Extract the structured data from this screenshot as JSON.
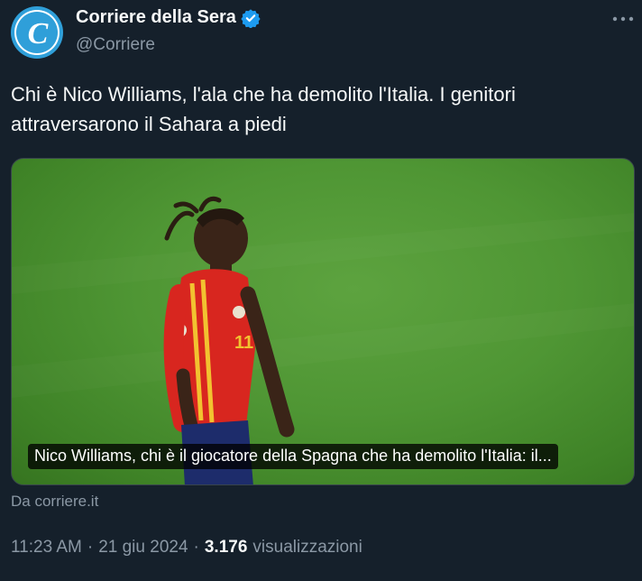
{
  "author": {
    "display_name": "Corriere della Sera",
    "handle": "@Corriere",
    "avatar_letter": "C",
    "verified": true
  },
  "menu": {
    "icon": "more-horizontal-icon"
  },
  "tweet": {
    "text": "Chi è Nico Williams, l'ala che ha demolito l'Italia. I genitori attraversarono il Sahara a piedi"
  },
  "card": {
    "caption": "Nico Williams, chi è il giocatore della Spagna che ha demolito l'Italia: il...",
    "jersey_number": "11",
    "source": "Da corriere.it"
  },
  "meta": {
    "time": "11:23 AM",
    "separator": "·",
    "date": "21 giu 2024",
    "views_count": "3.176",
    "views_label": "visualizzazioni"
  },
  "colors": {
    "background": "#15202b",
    "text_primary": "#f7f9f9",
    "text_secondary": "#8b98a5",
    "verified_blue": "#1d9bf0",
    "avatar_blue": "#2f9fd9",
    "pitch_green": "#4f9634"
  }
}
